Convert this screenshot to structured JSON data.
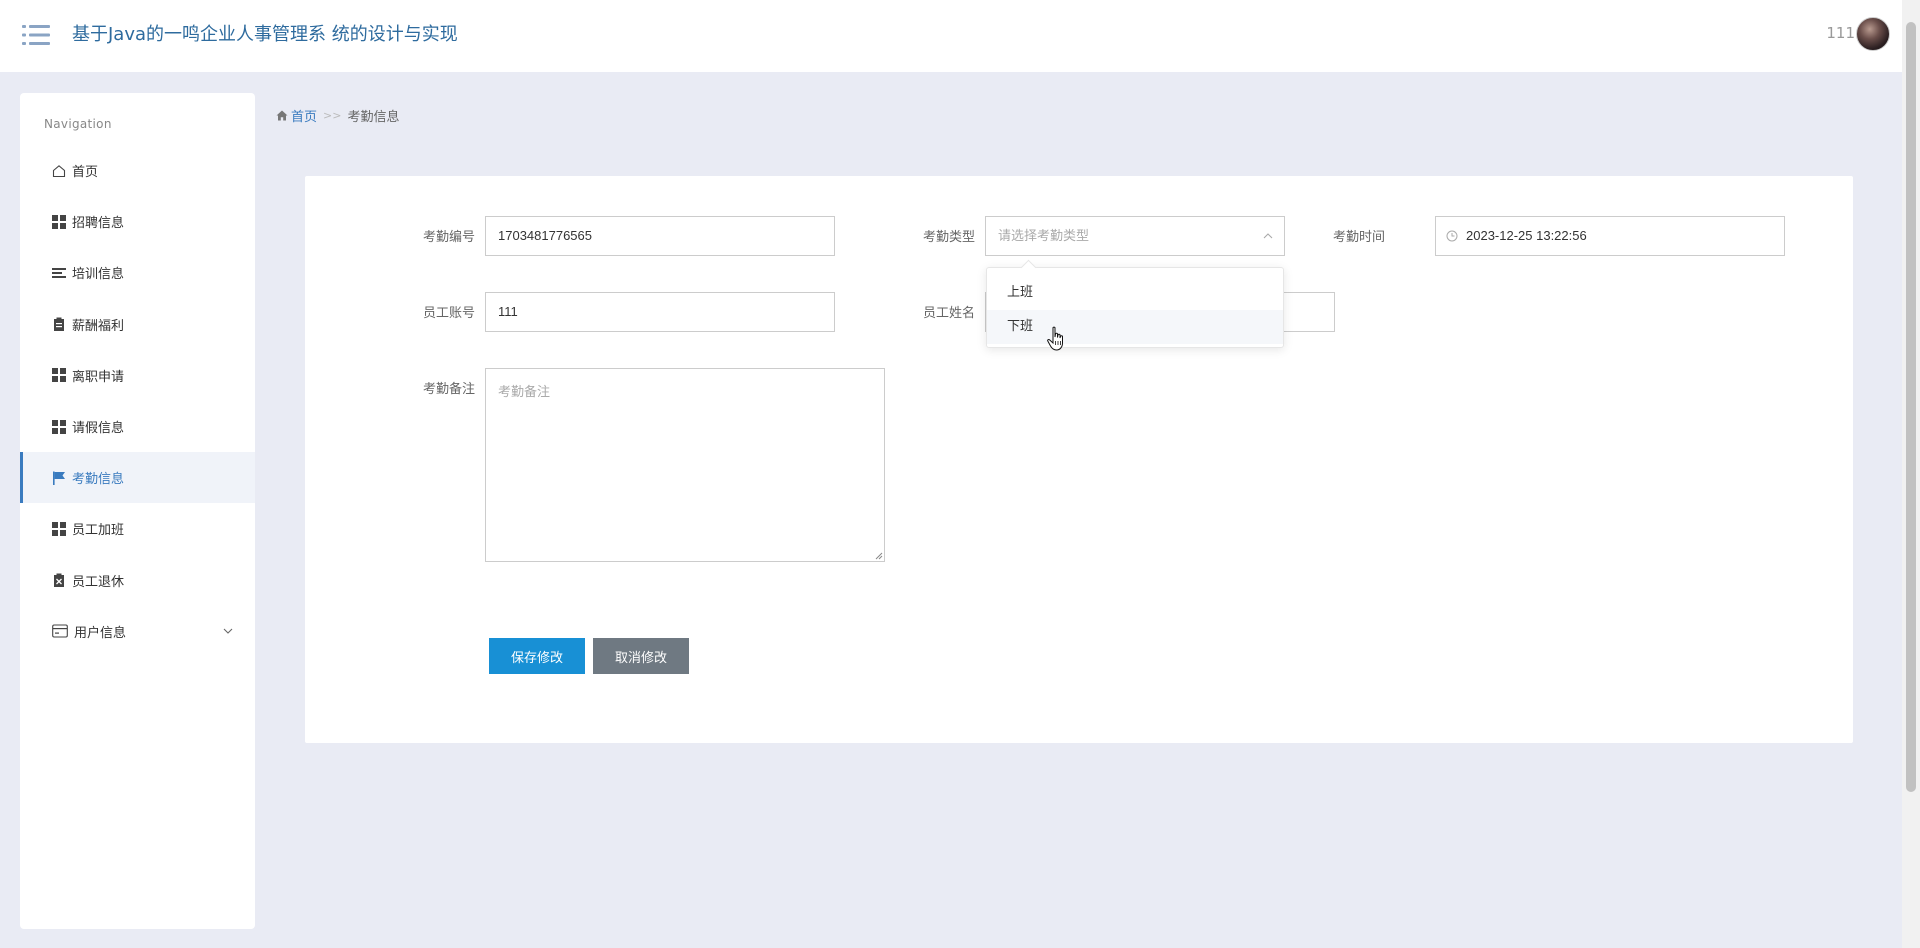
{
  "header": {
    "title": "基于Java的一鸣企业人事管理系 统的设计与实现",
    "username": "111"
  },
  "sidebar": {
    "nav_title": "Navigation",
    "items": [
      {
        "label": "首页",
        "icon": "home-icon"
      },
      {
        "label": "招聘信息",
        "icon": "grid-icon"
      },
      {
        "label": "培训信息",
        "icon": "list-icon"
      },
      {
        "label": "薪酬福利",
        "icon": "clipboard-icon"
      },
      {
        "label": "离职申请",
        "icon": "grid-icon"
      },
      {
        "label": "请假信息",
        "icon": "grid-icon"
      },
      {
        "label": "考勤信息",
        "icon": "flag-icon",
        "active": true
      },
      {
        "label": "员工加班",
        "icon": "grid-icon"
      },
      {
        "label": "员工退休",
        "icon": "clipboard-x-icon"
      },
      {
        "label": "用户信息",
        "icon": "wallet-icon",
        "expandable": true
      }
    ]
  },
  "breadcrumb": {
    "home": "首页",
    "separator": ">>",
    "current": "考勤信息"
  },
  "form": {
    "attendance_no": {
      "label": "考勤编号",
      "value": "1703481776565"
    },
    "attendance_type": {
      "label": "考勤类型",
      "placeholder": "请选择考勤类型"
    },
    "attendance_time": {
      "label": "考勤时间",
      "value": "2023-12-25 13:22:56"
    },
    "employee_account": {
      "label": "员工账号",
      "value": "111"
    },
    "employee_name": {
      "label": "员工姓名",
      "value": ""
    },
    "remark": {
      "label": "考勤备注",
      "placeholder": "考勤备注"
    },
    "save_label": "保存修改",
    "cancel_label": "取消修改"
  },
  "dropdown": {
    "options": [
      "上班",
      "下班"
    ],
    "hovered_index": 1
  },
  "colors": {
    "primary": "#1890d5",
    "accent": "#3a7bbf",
    "cancel": "#6f7982",
    "background": "#e9ebf4"
  }
}
